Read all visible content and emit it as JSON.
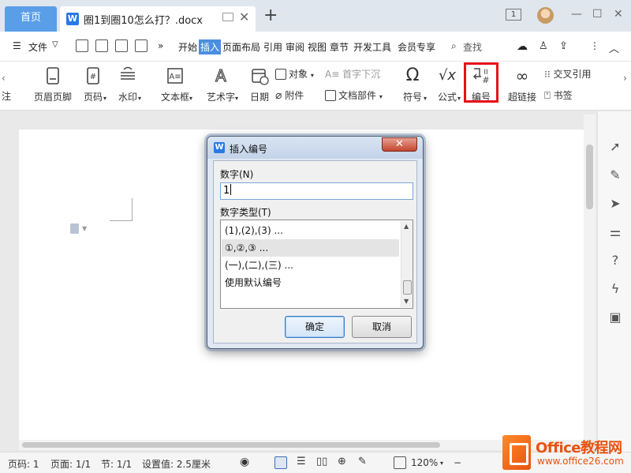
{
  "titlebar": {
    "home_tab": "首页",
    "doc_tab_title": "圈1到圈10怎么打？.docx",
    "add_tab": "+",
    "page_count_badge": "1",
    "minimize": "—",
    "maximize": "☐",
    "close": "✕"
  },
  "menubar": {
    "file": "文件",
    "more": "»",
    "tabs": [
      "开始",
      "插入",
      "页面布局",
      "引用",
      "审阅",
      "视图",
      "章节",
      "开发工具",
      "会员专享"
    ],
    "active_tab": "插入",
    "search": "查找"
  },
  "ribbon": {
    "cut_left": "注",
    "header_footer": "页眉页脚",
    "page_number": "页码",
    "watermark": "水印",
    "text_box": "文本框",
    "word_art": "艺术字",
    "date": "日期",
    "object": "对象",
    "attachment": "附件",
    "drop_cap": "首字下沉",
    "doc_parts": "文档部件",
    "symbol": "符号",
    "formula": "公式",
    "numbering": "编号",
    "hyperlink": "超链接",
    "cross_ref": "交叉引用",
    "bookmark": "书签"
  },
  "dialog": {
    "title": "插入编号",
    "close": "✕",
    "number_label": "数字(N)",
    "number_value": "1",
    "type_label": "数字类型(T)",
    "types": [
      "(1),(2),(3) ...",
      "①,②,③ ...",
      "(一),(二),(三) ...",
      "使用默认编号"
    ],
    "selected_type_index": 1,
    "ok": "确定",
    "cancel": "取消"
  },
  "statusbar": {
    "page_num": "页码: 1",
    "page": "页面: 1/1",
    "section": "节: 1/1",
    "setting": "设置值: 2.5厘米",
    "zoom": "120%"
  },
  "watermark_logo": {
    "name": "Office教程网",
    "url": "www.office26.com"
  },
  "colors": {
    "accent": "#4a8ee0",
    "highlight_box": "#e8101a",
    "logo": "#e8520f"
  }
}
